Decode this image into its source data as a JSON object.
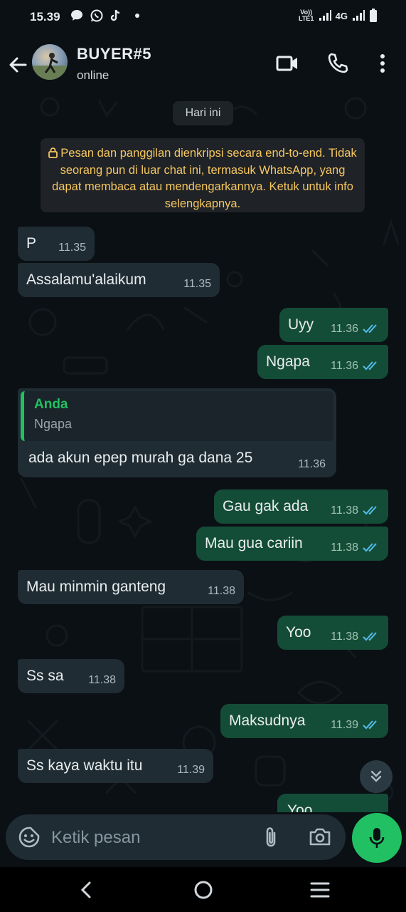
{
  "status_bar": {
    "time": "15.39",
    "network_label": "Vo)) LTE1",
    "network_type": "4G"
  },
  "header": {
    "contact_name": "BUYER#5",
    "contact_status": "online"
  },
  "chat": {
    "date_chip": "Hari ini",
    "encryption_notice": "Pesan dan panggilan dienkripsi secara end-to-end. Tidak seorang pun di luar chat ini, termasuk WhatsApp, yang dapat membaca atau mendengarkannya. Ketuk untuk info selengkapnya.",
    "messages": [
      {
        "text": "P",
        "time": "11.35",
        "direction": "in"
      },
      {
        "text": "Assalamu'alaikum",
        "time": "11.35",
        "direction": "in"
      },
      {
        "text": "Uyy",
        "time": "11.36",
        "direction": "out"
      },
      {
        "text": "Ngapa",
        "time": "11.36",
        "direction": "out"
      },
      {
        "text": "ada akun epep murah ga  dana 25",
        "time": "11.36",
        "direction": "in",
        "reply_to": {
          "author": "Anda",
          "text": "Ngapa"
        }
      },
      {
        "text": "Gau gak ada",
        "time": "11.38",
        "direction": "out"
      },
      {
        "text": "Mau gua cariin",
        "time": "11.38",
        "direction": "out"
      },
      {
        "text": "Mau minmin ganteng",
        "time": "11.38",
        "direction": "in"
      },
      {
        "text": "Yoo",
        "time": "11.38",
        "direction": "out"
      },
      {
        "text": "Ss sa",
        "time": "11.38",
        "direction": "in"
      },
      {
        "text": "Maksudnya",
        "time": "11.39",
        "direction": "out"
      },
      {
        "text": "Ss kaya waktu itu",
        "time": "11.39",
        "direction": "in"
      },
      {
        "text": "Yoo",
        "time": "",
        "direction": "out"
      }
    ]
  },
  "composer": {
    "placeholder": "Ketik pesan"
  },
  "colors": {
    "accent": "#21c063",
    "outgoing_bubble": "#144d37",
    "incoming_bubble": "#1f2c33",
    "read_ticks": "#53bdeb"
  }
}
